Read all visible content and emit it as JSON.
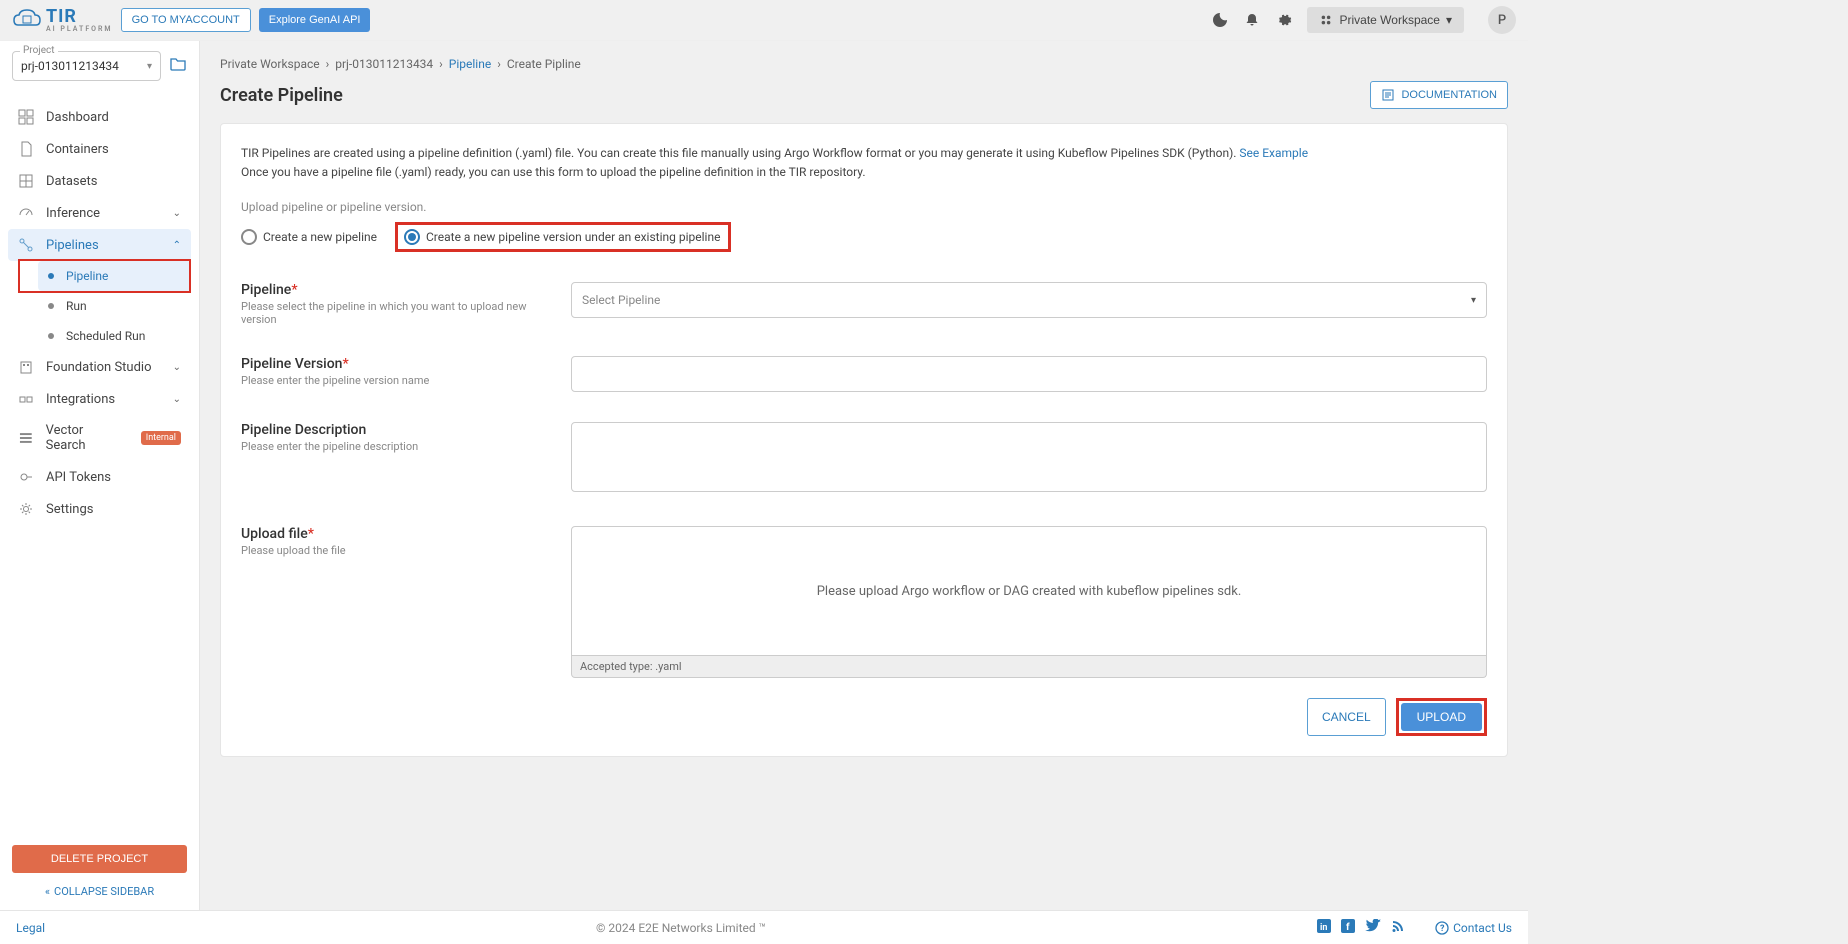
{
  "topbar": {
    "logo_title": "TIR",
    "logo_sub": "AI PLATFORM",
    "go_myaccount": "GO TO MYACCOUNT",
    "explore_api": "Explore GenAI API",
    "workspace_label": "Private Workspace",
    "avatar_letter": "P"
  },
  "sidebar": {
    "project_label": "Project",
    "project_value": "prj-013011213434",
    "items": {
      "dashboard": "Dashboard",
      "containers": "Containers",
      "datasets": "Datasets",
      "inference": "Inference",
      "pipelines": "Pipelines",
      "pipeline": "Pipeline",
      "run": "Run",
      "scheduled_run": "Scheduled Run",
      "foundation": "Foundation Studio",
      "integrations": "Integrations",
      "vector": "Vector Search",
      "vector_badge": "Internal",
      "api_tokens": "API Tokens",
      "settings": "Settings"
    },
    "delete_btn": "DELETE PROJECT",
    "collapse": "COLLAPSE SIDEBAR"
  },
  "breadcrumb": {
    "b1": "Private Workspace",
    "b2": "prj-013011213434",
    "b3": "Pipeline",
    "b4": "Create Pipline"
  },
  "page": {
    "title": "Create Pipeline",
    "doc_btn": "DOCUMENTATION",
    "intro1": "TIR Pipelines are created using a pipeline definition (.yaml) file. You can create this file manually using Argo Workflow format or you may generate it using Kubeflow Pipelines SDK (Python). ",
    "see_example": "See Example",
    "intro2": "Once you have a pipeline file (.yaml) ready, you can use this form to upload the pipeline definition in the TIR repository.",
    "upload_section_label": "Upload pipeline or pipeline version.",
    "radio_new": "Create a new pipeline",
    "radio_version": "Create a new pipeline version under an existing pipeline",
    "fields": {
      "pipeline_title": "Pipeline",
      "pipeline_desc": "Please select the pipeline in which you want to upload new version",
      "pipeline_placeholder": "Select Pipeline",
      "version_title": "Pipeline Version",
      "version_desc": "Please enter the pipeline version name",
      "desc_title": "Pipeline Description",
      "desc_desc": "Please enter the pipeline description",
      "upload_title": "Upload file",
      "upload_desc": "Please upload the file",
      "upload_placeholder": "Please upload Argo workflow or DAG created with kubeflow pipelines sdk.",
      "upload_hint": "Accepted type: .yaml"
    },
    "cancel_btn": "CANCEL",
    "upload_btn": "UPLOAD"
  },
  "footer": {
    "legal": "Legal",
    "copyright": "© 2024 E2E Networks Limited ™",
    "contact": "Contact Us"
  }
}
